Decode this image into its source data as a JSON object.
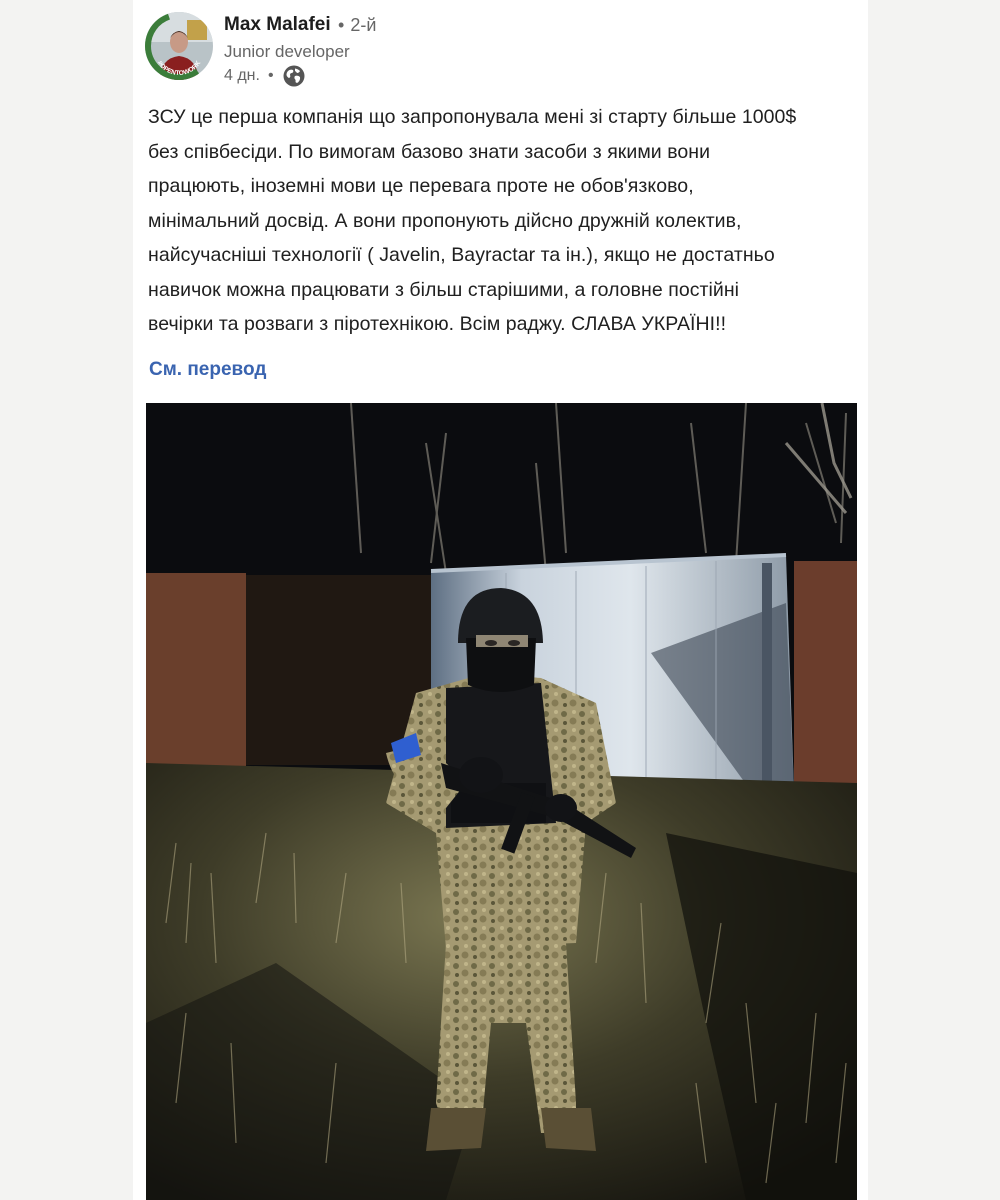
{
  "post": {
    "author": {
      "name": "Max Malafei",
      "connection": "2-й",
      "headline": "Junior developer",
      "avatar_badge_text": "#OPENTOWORK"
    },
    "time": "4 дн.",
    "visibility_icon": "globe-icon",
    "text": "ЗСУ це перша компанія що запропонувала мені зі старту більше 1000$\nбез співбесіди. По вимогам базово знати засоби з якими вони\nпрацюють, іноземні мови це перевага проте не обов'язково,\nмінімальний досвід. А вони пропонують дійсно дружній колектив,\nнайсучасніші технології ( Javelin, Bayractar та ін.), якщо не достатньо\nнавичок можна працювати з більш старішими, а головне постійні\nвечірки та розваги з піротехнікою. Всім раджу. СЛАВА УКРАЇНІ!!",
    "translate_label": "См. перевод"
  },
  "colors": {
    "page_bg": "#f3f3f2",
    "card_bg": "#ffffff",
    "name": "#1d1d1d",
    "muted": "#666666",
    "link": "#3a64b0",
    "open_to_work_ring": "#3b7d3a"
  }
}
